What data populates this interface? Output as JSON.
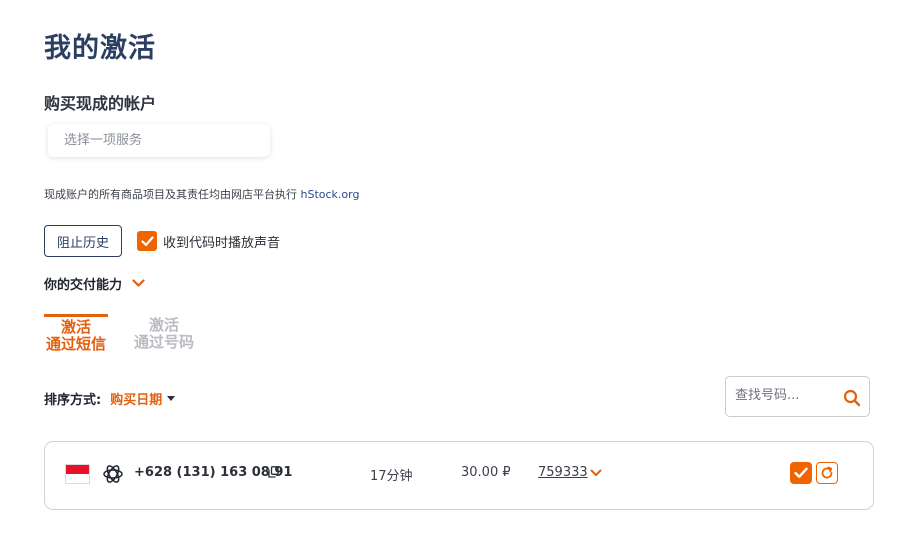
{
  "page": {
    "title": "我的激活"
  },
  "purchase": {
    "title": "购买现成的帐户",
    "service_placeholder": "选择一项服务",
    "disclaimer_text": "现成账户的所有商品项目及其责任均由网店平台执行 ",
    "disclaimer_link": "hStock.org"
  },
  "controls": {
    "block_history_label": "阻止历史",
    "sound_checked": true,
    "sound_label": "收到代码时播放声音"
  },
  "capability": {
    "label": "你的交付能力",
    "icon": "chevron-down-icon"
  },
  "tabs": [
    {
      "line1": "激活",
      "line2": "通过短信",
      "active": true
    },
    {
      "line1": "激活",
      "line2": "通过号码",
      "active": false
    }
  ],
  "sort": {
    "label": "排序方式:",
    "value": "购买日期"
  },
  "search": {
    "placeholder": "查找号码..."
  },
  "activations": [
    {
      "country_flag": "indonesia-flag",
      "service_icon": "openai-icon",
      "phone": "+628 (131) 163 08 91",
      "duration": "17分钟",
      "price": "30.00 ₽",
      "code": "759333"
    }
  ],
  "colors": {
    "accent": "#f06400",
    "title": "#2b3f63",
    "tab_inactive": "#b9bcc2"
  }
}
